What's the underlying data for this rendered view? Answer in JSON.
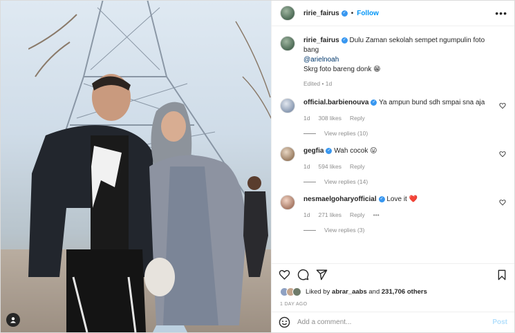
{
  "post": {
    "author": "ririe_fairus",
    "follow_label": "Follow",
    "dot": "•",
    "caption_line1": "Dulu Zaman sekolah sempet ngumpulin foto bang",
    "caption_mention": "@arielnoah",
    "caption_line2": "Skrg foto bareng donk 😁",
    "edited": "Edited • 1d"
  },
  "comments": [
    {
      "user": "official.barbienouva",
      "text": "Ya ampun bund sdh smpai sna aja",
      "age": "1d",
      "likes": "308 likes",
      "reply": "Reply",
      "view_replies": "View replies (10)",
      "avatar_color": "#c7d0e0"
    },
    {
      "user": "gegfia",
      "text": "Wah cocok 😛",
      "age": "1d",
      "likes": "594 likes",
      "reply": "Reply",
      "view_replies": "View replies (14)",
      "avatar_color": "#c9b39c"
    },
    {
      "user": "nesmaelgoharyofficial",
      "text": "Love it ❤️",
      "age": "1d",
      "likes": "271 likes",
      "reply": "Reply",
      "more": "•••",
      "view_replies": "View replies (3)",
      "avatar_color": "#d8b7a6"
    }
  ],
  "likes_line": {
    "prefix": "Liked by",
    "user": "abrar_aabs",
    "mid": "and",
    "count": "231,706 others"
  },
  "time_ago": "1 DAY AGO",
  "add_comment": {
    "placeholder": "Add a comment...",
    "post_label": "Post"
  },
  "icons": [
    "verified-icon",
    "more-icon",
    "heart-icon",
    "comment-icon",
    "share-icon",
    "bookmark-icon",
    "emoji-icon",
    "user-tag-icon"
  ],
  "colors": {
    "accent": "#0095f6",
    "verified": "#3897f0",
    "muted": "#8e8e8e",
    "heart_red": "#ed4956"
  }
}
